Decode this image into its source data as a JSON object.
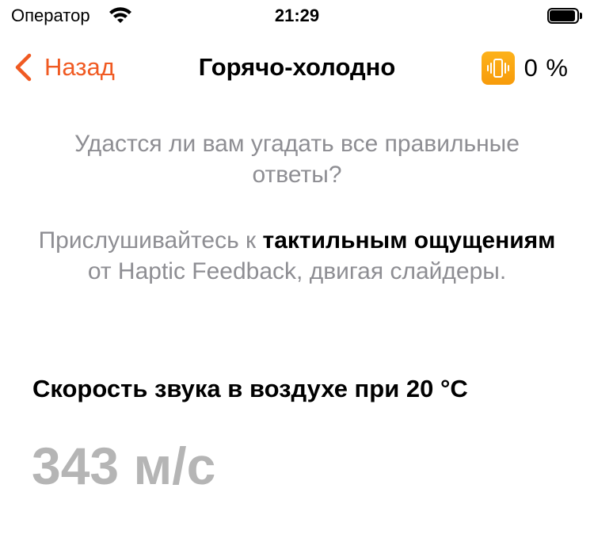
{
  "status_bar": {
    "carrier": "Оператор",
    "time": "21:29"
  },
  "nav": {
    "back_label": "Назад",
    "title": "Горячо-холодно",
    "haptic_percent": "0 %",
    "accent_color": "#f05a22",
    "haptic_icon": "vibration-phone-icon"
  },
  "intro": {
    "line1": "Удастся ли вам угадать все правильные ответы?",
    "line2_prefix": "Прислушивайтесь к ",
    "line2_bold": "тактильным ощущениям",
    "line2_suffix": " от Haptic Feedback, двигая слайдеры."
  },
  "question": {
    "title": "Скорость звука в воздухе при 20 °C",
    "answer": "343 м/с"
  }
}
